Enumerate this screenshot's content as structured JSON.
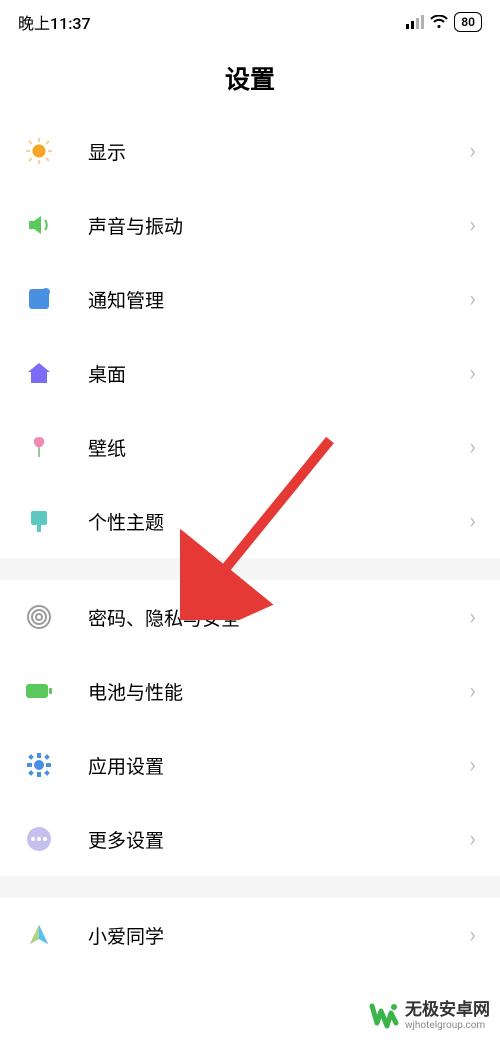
{
  "status": {
    "time": "晚上11:37",
    "battery": "80"
  },
  "page": {
    "title": "设置"
  },
  "group1": [
    {
      "label": "显示",
      "icon": "brightness-icon"
    },
    {
      "label": "声音与振动",
      "icon": "sound-icon"
    },
    {
      "label": "通知管理",
      "icon": "notification-icon"
    },
    {
      "label": "桌面",
      "icon": "home-icon"
    },
    {
      "label": "壁纸",
      "icon": "wallpaper-icon"
    },
    {
      "label": "个性主题",
      "icon": "theme-icon"
    }
  ],
  "group2": [
    {
      "label": "密码、隐私与安全",
      "icon": "fingerprint-icon"
    },
    {
      "label": "电池与性能",
      "icon": "battery-icon"
    },
    {
      "label": "应用设置",
      "icon": "app-settings-icon"
    },
    {
      "label": "更多设置",
      "icon": "more-icon"
    }
  ],
  "group3": [
    {
      "label": "小爱同学",
      "icon": "xiaoai-icon"
    }
  ],
  "watermark": {
    "main": "无极安卓网",
    "sub": "wjhotelgroup.com"
  }
}
